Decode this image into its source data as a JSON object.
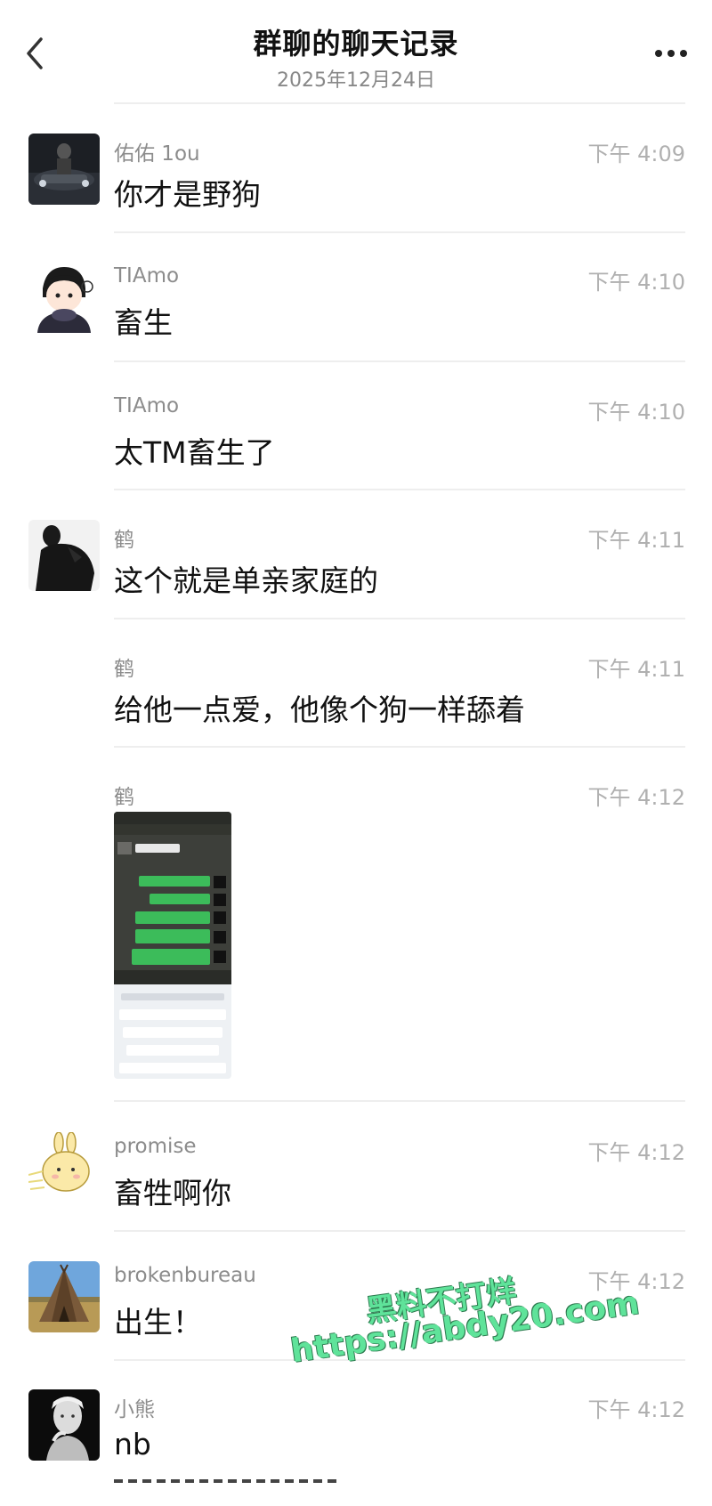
{
  "header": {
    "title": "群聊的聊天记录",
    "date": "2025年12月24日",
    "back_icon": "chevron-left-icon",
    "more_icon": "more-dots-icon"
  },
  "messages": [
    {
      "sender": "佑佑 1ou",
      "time": "下午 4:09",
      "text": "你才是野狗"
    },
    {
      "sender": "TIAmo",
      "time": "下午 4:10",
      "text": "畜生"
    },
    {
      "sender": "TIAmo",
      "time": "下午 4:10",
      "text": "太TM畜生了"
    },
    {
      "sender": "鹤",
      "time": "下午 4:11",
      "text": "这个就是单亲家庭的"
    },
    {
      "sender": "鹤",
      "time": "下午 4:11",
      "text": "给他一点爱，他像个狗一样舔着"
    },
    {
      "sender": "鹤",
      "time": "下午 4:12",
      "text": ""
    },
    {
      "sender": "promise",
      "time": "下午 4:12",
      "text": "畜牲啊你"
    },
    {
      "sender": "brokenbureau",
      "time": "下午 4:12",
      "text": "出生！"
    },
    {
      "sender": "小熊",
      "time": "下午 4:12",
      "text": "nb"
    }
  ],
  "watermark": {
    "line1": "黑料不打烊",
    "line2": "https://abdy20.com"
  },
  "colors": {
    "background": "#ffffff",
    "divider": "#eeeeee",
    "sender": "#8c8c8c",
    "time": "#b0b0b0",
    "watermark": "#5fe39a"
  }
}
